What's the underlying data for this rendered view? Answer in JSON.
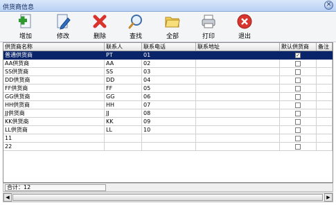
{
  "window": {
    "title": "供货商信息"
  },
  "toolbar": [
    {
      "label": "增加",
      "icon": "add-document-icon"
    },
    {
      "label": "修改",
      "icon": "edit-document-icon"
    },
    {
      "label": "删除",
      "icon": "delete-x-icon"
    },
    {
      "label": "查找",
      "icon": "magnifier-icon"
    },
    {
      "label": "全部",
      "icon": "folder-icon"
    },
    {
      "label": "打印",
      "icon": "printer-icon"
    },
    {
      "label": "退出",
      "icon": "exit-icon"
    }
  ],
  "grid": {
    "columns": [
      "供货商名称",
      "联系人",
      "联系电话",
      "联系地址",
      "默认供货商",
      "备注"
    ],
    "rows": [
      {
        "name": "普通供货商",
        "contact": "PT",
        "phone": "01",
        "address": "",
        "default": true,
        "note": ""
      },
      {
        "name": "AA供货商",
        "contact": "AA",
        "phone": "02",
        "address": "",
        "default": false,
        "note": ""
      },
      {
        "name": "SS供货商",
        "contact": "SS",
        "phone": "03",
        "address": "",
        "default": false,
        "note": ""
      },
      {
        "name": "DD供货商",
        "contact": "DD",
        "phone": "04",
        "address": "",
        "default": false,
        "note": ""
      },
      {
        "name": "FF供货商",
        "contact": "FF",
        "phone": "05",
        "address": "",
        "default": false,
        "note": ""
      },
      {
        "name": "GG供货商",
        "contact": "GG",
        "phone": "06",
        "address": "",
        "default": false,
        "note": ""
      },
      {
        "name": "HH供货商",
        "contact": "HH",
        "phone": "07",
        "address": "",
        "default": false,
        "note": ""
      },
      {
        "name": "JJ供货商",
        "contact": "JJ",
        "phone": "08",
        "address": "",
        "default": false,
        "note": ""
      },
      {
        "name": "KK供货商",
        "contact": "KK",
        "phone": "09",
        "address": "",
        "default": false,
        "note": ""
      },
      {
        "name": "LL供货商",
        "contact": "LL",
        "phone": "10",
        "address": "",
        "default": false,
        "note": ""
      },
      {
        "name": "11",
        "contact": "",
        "phone": "",
        "address": "",
        "default": false,
        "note": ""
      },
      {
        "name": "22",
        "contact": "",
        "phone": "",
        "address": "",
        "default": false,
        "note": ""
      }
    ],
    "selected_row": 0,
    "colors": {
      "selection": "#0a246a"
    }
  },
  "status": {
    "total": "合计：12"
  }
}
